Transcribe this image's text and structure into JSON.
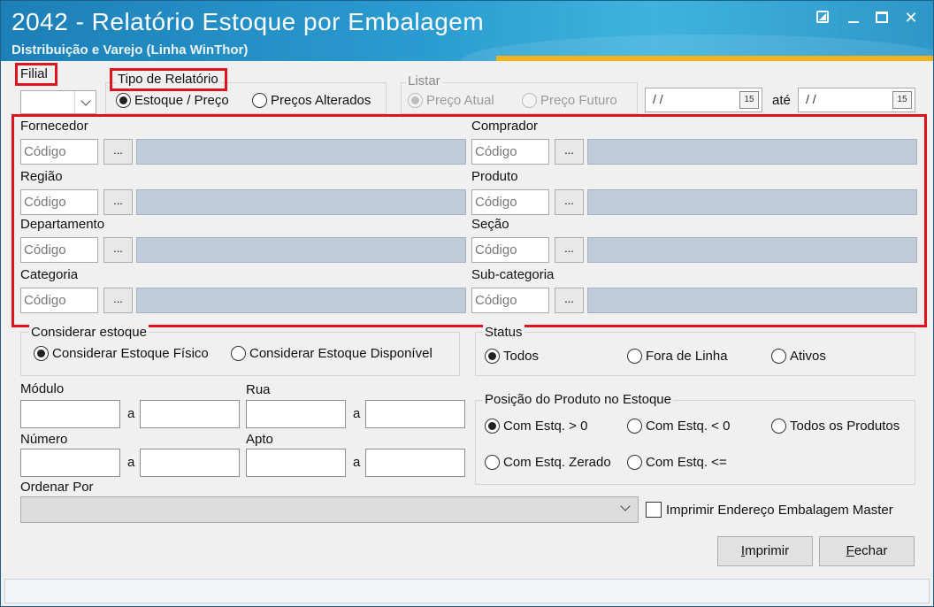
{
  "window": {
    "title": "2042 - Relatório Estoque por Embalagem",
    "subtitle": "Distribuição e Varejo (Linha WinThor)"
  },
  "filial": {
    "label": "Filial",
    "value": ""
  },
  "tipo_relatorio": {
    "label": "Tipo de Relatório",
    "options": [
      {
        "label": "Estoque / Preço",
        "checked": true
      },
      {
        "label": "Preços Alterados",
        "checked": false
      }
    ]
  },
  "listar": {
    "label": "Listar",
    "options": [
      {
        "label": "Preço Atual",
        "checked": true
      },
      {
        "label": "Preço Futuro",
        "checked": false
      }
    ],
    "date_from": "/ /",
    "ate_label": "até",
    "date_to": "/ /",
    "calendar_icon": "calendar-icon",
    "calendar_text": "15"
  },
  "filters": {
    "code_placeholder": "Código",
    "lookup_label": "...",
    "items": [
      {
        "label": "Fornecedor",
        "code": "Código"
      },
      {
        "label": "Comprador",
        "code": "Código"
      },
      {
        "label": "Região",
        "code": "Código"
      },
      {
        "label": "Produto",
        "code": "Código"
      },
      {
        "label": "Departamento",
        "code": "Código"
      },
      {
        "label": "Seção",
        "code": "Código"
      },
      {
        "label": "Categoria",
        "code": "Código"
      },
      {
        "label": "Sub-categoria",
        "code": "Código"
      }
    ]
  },
  "considerar_estoque": {
    "label": "Considerar estoque",
    "options": [
      {
        "label": "Considerar Estoque Físico",
        "checked": true
      },
      {
        "label": "Considerar Estoque Disponível",
        "checked": false
      }
    ]
  },
  "status": {
    "label": "Status",
    "options": [
      {
        "label": "Todos",
        "checked": true
      },
      {
        "label": "Fora de Linha",
        "checked": false
      },
      {
        "label": "Ativos",
        "checked": false
      }
    ]
  },
  "ranges": {
    "modulo": "Módulo",
    "rua": "Rua",
    "numero": "Número",
    "apto": "Apto",
    "a": "a"
  },
  "posicao": {
    "label": "Posição do Produto no Estoque",
    "options": [
      {
        "label": "Com Estq. > 0",
        "checked": true
      },
      {
        "label": "Com Estq. < 0",
        "checked": false
      },
      {
        "label": "Todos os Produtos",
        "checked": false
      },
      {
        "label": "Com Estq. Zerado",
        "checked": false
      },
      {
        "label": "Com Estq. <=",
        "checked": false
      }
    ]
  },
  "ordenar": {
    "label": "Ordenar Por",
    "value": ""
  },
  "imprimir_endereco": {
    "label": "Imprimir Endereço Embalagem Master",
    "checked": false
  },
  "buttons": {
    "imprimir_key": "I",
    "imprimir_rest": "mprimir",
    "fechar_key": "F",
    "fechar_rest": "echar"
  }
}
